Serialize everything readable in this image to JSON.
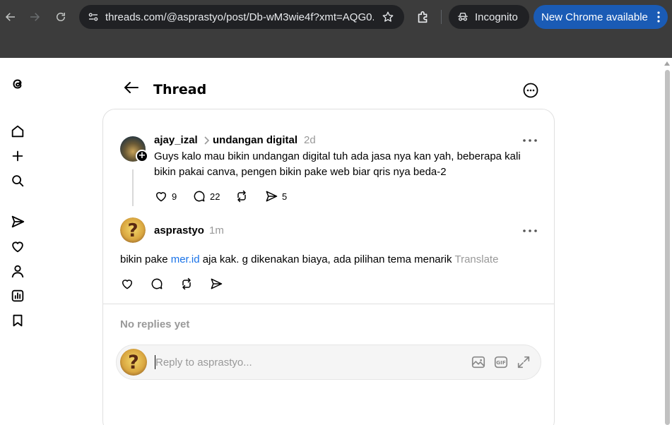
{
  "browser": {
    "url": "threads.com/@asprastyo/post/Db-wM3wie4f?xmt=AQG0...",
    "incognito_label": "Incognito",
    "update_label": "New Chrome available"
  },
  "header": {
    "title": "Thread"
  },
  "parent_post": {
    "author": "ajay_izal",
    "topic": "undangan digital",
    "time": "2d",
    "text_line1": "Guys kalo mau bikin undangan digital tuh ada jasa nya kan yah, beberapa kali",
    "text_line2": "bikin pakai canva, pengen bikin pake web biar qris nya beda-2",
    "likes": "9",
    "replies": "22",
    "shares": "5"
  },
  "reply_post": {
    "author": "asprastyo",
    "time": "1m",
    "text_before": "bikin pake ",
    "link": "mer.id",
    "text_after": " aja kak. g dikenakan biaya, ada pilihan tema menarik",
    "translate": "Translate"
  },
  "replies_section": {
    "empty_label": "No replies yet"
  },
  "composer": {
    "placeholder": "Reply to asprastyo..."
  },
  "colors": {
    "chrome_bg": "#3c3c3c",
    "omnibox_bg": "#202124",
    "update_bg": "#1a5bb5",
    "link": "#1a73e8",
    "muted": "#999999"
  }
}
